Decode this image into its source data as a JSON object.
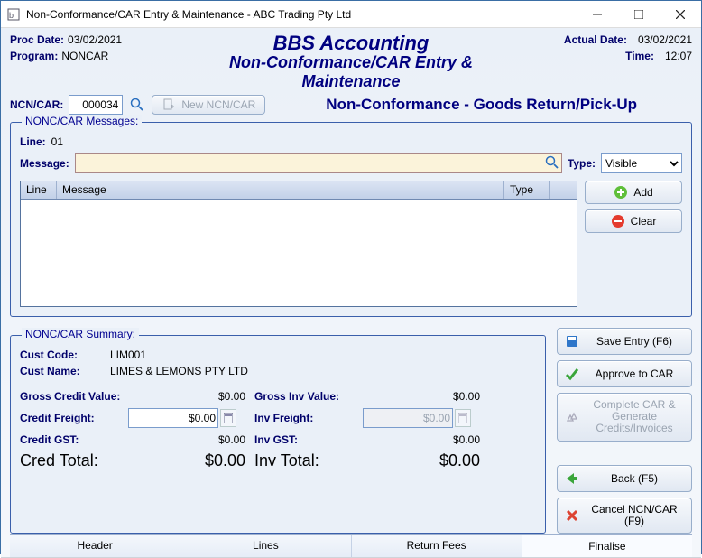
{
  "window": {
    "title": "Non-Conformance/CAR Entry & Maintenance - ABC Trading Pty Ltd"
  },
  "header": {
    "proc_date_label": "Proc Date:",
    "proc_date": "03/02/2021",
    "program_label": "Program:",
    "program": "NONCAR",
    "brand": "BBS Accounting",
    "subtitle": "Non-Conformance/CAR Entry & Maintenance",
    "actual_date_label": "Actual Date:",
    "actual_date": "03/02/2021",
    "time_label": "Time:",
    "time": "12:07"
  },
  "toolbar": {
    "ncn_label": "NCN/CAR:",
    "ncn_value": "000034",
    "new_btn": "New NCN/CAR",
    "mode_title": "Non-Conformance - Goods Return/Pick-Up"
  },
  "messages_panel": {
    "title": "NONC/CAR Messages:",
    "line_label": "Line:",
    "line_value": "01",
    "message_label": "Message:",
    "message_value": "",
    "type_label": "Type:",
    "type_value": "Visible",
    "grid": {
      "col_line": "Line",
      "col_message": "Message",
      "col_type": "Type"
    },
    "add_btn": "Add",
    "clear_btn": "Clear"
  },
  "summary_panel": {
    "title": "NONC/CAR Summary:",
    "cust_code_label": "Cust Code:",
    "cust_code": "LIM001",
    "cust_name_label": "Cust Name:",
    "cust_name": "LIMES & LEMONS PTY LTD",
    "gross_credit_label": "Gross Credit Value:",
    "gross_credit": "$0.00",
    "credit_freight_label": "Credit Freight:",
    "credit_freight": "$0.00",
    "credit_gst_label": "Credit GST:",
    "credit_gst": "$0.00",
    "cred_total_label": "Cred Total:",
    "cred_total": "$0.00",
    "gross_inv_label": "Gross Inv Value:",
    "gross_inv": "$0.00",
    "inv_freight_label": "Inv Freight:",
    "inv_freight": "$0.00",
    "inv_gst_label": "Inv GST:",
    "inv_gst": "$0.00",
    "inv_total_label": "Inv Total:",
    "inv_total": "$0.00"
  },
  "actions": {
    "save": "Save Entry (F6)",
    "approve": "Approve to CAR",
    "complete": "Complete CAR & Generate Credits/Invoices",
    "back": "Back (F5)",
    "cancel": "Cancel NCN/CAR (F9)"
  },
  "tabs": {
    "header": "Header",
    "lines": "Lines",
    "return_fees": "Return Fees",
    "finalise": "Finalise"
  },
  "colors": {
    "accent": "#000080"
  }
}
